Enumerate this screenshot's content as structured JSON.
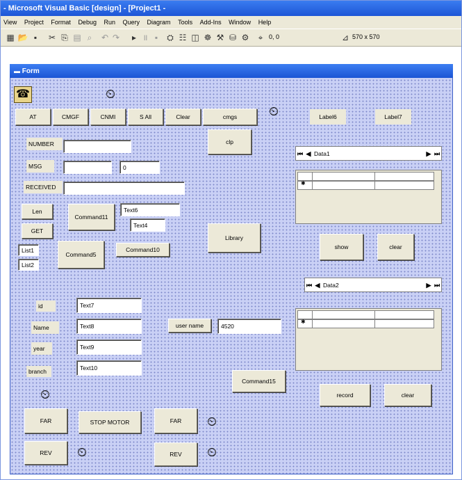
{
  "ide": {
    "title": "- Microsoft Visual Basic [design] - [Project1 -",
    "menus": [
      "View",
      "Project",
      "Format",
      "Debug",
      "Run",
      "Query",
      "Diagram",
      "Tools",
      "Add-Ins",
      "Window",
      "Help"
    ],
    "toolbar": {
      "position": "0, 0",
      "size": "570 x 570"
    }
  },
  "form": {
    "title": "Form",
    "top_buttons": [
      "AT",
      "CMGF",
      "CNMI",
      "S All",
      "Clear",
      "cmgs"
    ],
    "labels": {
      "label6": "Label6",
      "label7": "Label7",
      "number": "NUMBER",
      "msg": "MSG",
      "received": "RECEIVED",
      "list1": "List1",
      "list2": "List2",
      "id": "id",
      "name": "Name",
      "year": "year",
      "branch": "branch"
    },
    "textboxes": {
      "msg_count": "0",
      "text6": "Text6",
      "text4": "Text4",
      "text7": "Text7",
      "text8": "Text8",
      "text9": "Text9",
      "text10": "Text10",
      "user_name_value": "4520"
    },
    "buttons": {
      "clp": "clp",
      "len": "Len",
      "get": "GET",
      "command11": "Command11",
      "command5": "Command5",
      "command10": "Command10",
      "library": "Library",
      "show": "show",
      "clear1": "clear",
      "user_name": "user name",
      "command15": "Command15",
      "record": "record",
      "clear2": "clear",
      "far1": "FAR",
      "stop_motor": "STOP MOTOR",
      "far2": "FAR",
      "rev1": "REV",
      "rev2": "REV"
    },
    "data_controls": {
      "data1": "Data1",
      "data2": "Data2"
    }
  }
}
